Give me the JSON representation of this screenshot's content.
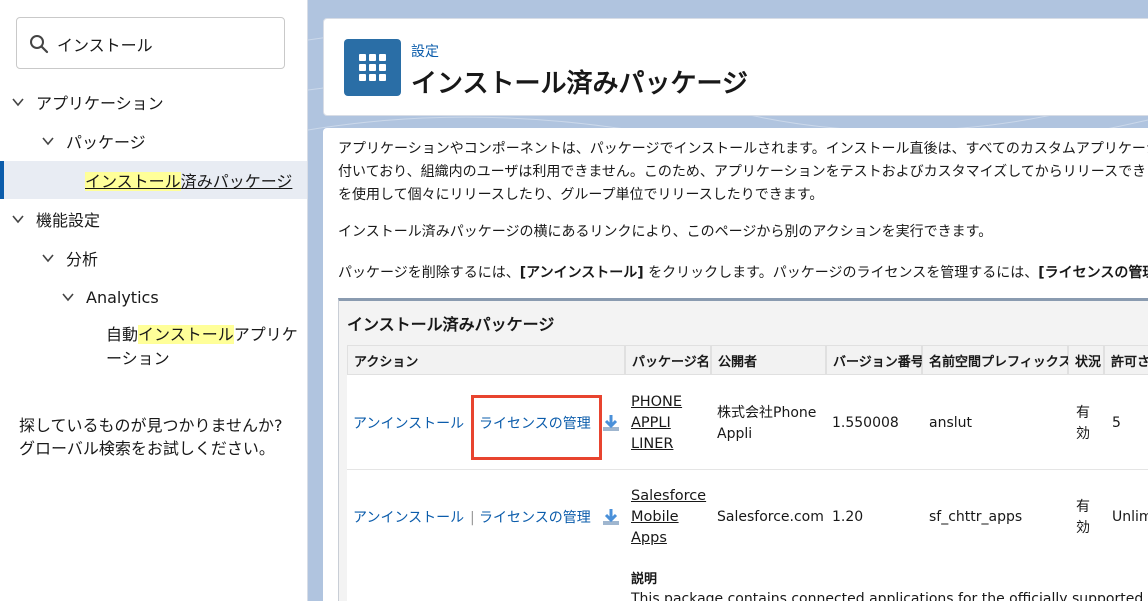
{
  "sidebar": {
    "search": {
      "value": "インストール",
      "placeholder": ""
    },
    "tree": [
      {
        "label": "アプリケーション"
      },
      {
        "label": "パッケージ"
      },
      {
        "label_hl": "インストール",
        "label_rest": "済みパッケージ"
      },
      {
        "label": "機能設定"
      },
      {
        "label": "分析"
      },
      {
        "label": "Analytics"
      },
      {
        "label_pre": "自動",
        "label_hl": "インストール",
        "label_post": "アプリケ",
        "label_line2": "ーション"
      }
    ],
    "help_line1": "探しているものが見つかりませんか?",
    "help_line2": "グローバル検索をお試しください。"
  },
  "header": {
    "breadcrumb": "設定",
    "title": "インストール済みパッケージ"
  },
  "content": {
    "para1_line1": "アプリケーションやコンポーネントは、パッケージでインストールされます。インストール直後は、すべてのカスタムアプリケーション",
    "para1_line2": "付いており、組織内のユーザは利用できません。このため、アプリケーションをテストおよびカスタマイズしてからリリースでき",
    "para1_line3": "を使用して個々にリリースしたり、グループ単位でリリースしたりできます。",
    "para2": "インストール済みパッケージの横にあるリンクにより、このページから別のアクションを実行できます。",
    "para3_pre": "パッケージを削除するには、",
    "para3_b1": "[アンインストール]",
    "para3_mid": " をクリックします。パッケージのライセンスを管理するには、",
    "para3_b2": "[ライセンスの管理"
  },
  "packages": {
    "title": "インストール済みパッケージ",
    "columns": [
      "アクション",
      "パッケージ名",
      "公開者",
      "バージョン番号",
      "名前空間プレフィックス",
      "状況",
      "許可さ"
    ],
    "rows": [
      {
        "uninstall": "アンインストール",
        "manage": "ライセンスの管理",
        "name_lines": [
          "PHONE",
          "APPLI",
          "LINER"
        ],
        "publisher_lines": [
          "株式会社Phone",
          "Appli"
        ],
        "version": "1.550008",
        "namespace": "anslut",
        "status_lines": [
          "有",
          "効"
        ],
        "allowed": "5"
      },
      {
        "uninstall": "アンインストール",
        "separator": "|",
        "manage": "ライセンスの管理",
        "name_lines": [
          "Salesforce",
          "Mobile",
          "Apps"
        ],
        "publisher": "Salesforce.com",
        "version": "1.20",
        "namespace": "sf_chttr_apps",
        "status_lines": [
          "有",
          "効"
        ],
        "allowed": "Unlim",
        "desc_label": "説明",
        "desc_text": "This package contains connected applications for the officially supported Sa"
      }
    ]
  },
  "colors": {
    "accent": "#0b5cab",
    "highlight": "#ffff99",
    "annotation": "#e8442f",
    "app_icon": "#2a6ea6"
  }
}
